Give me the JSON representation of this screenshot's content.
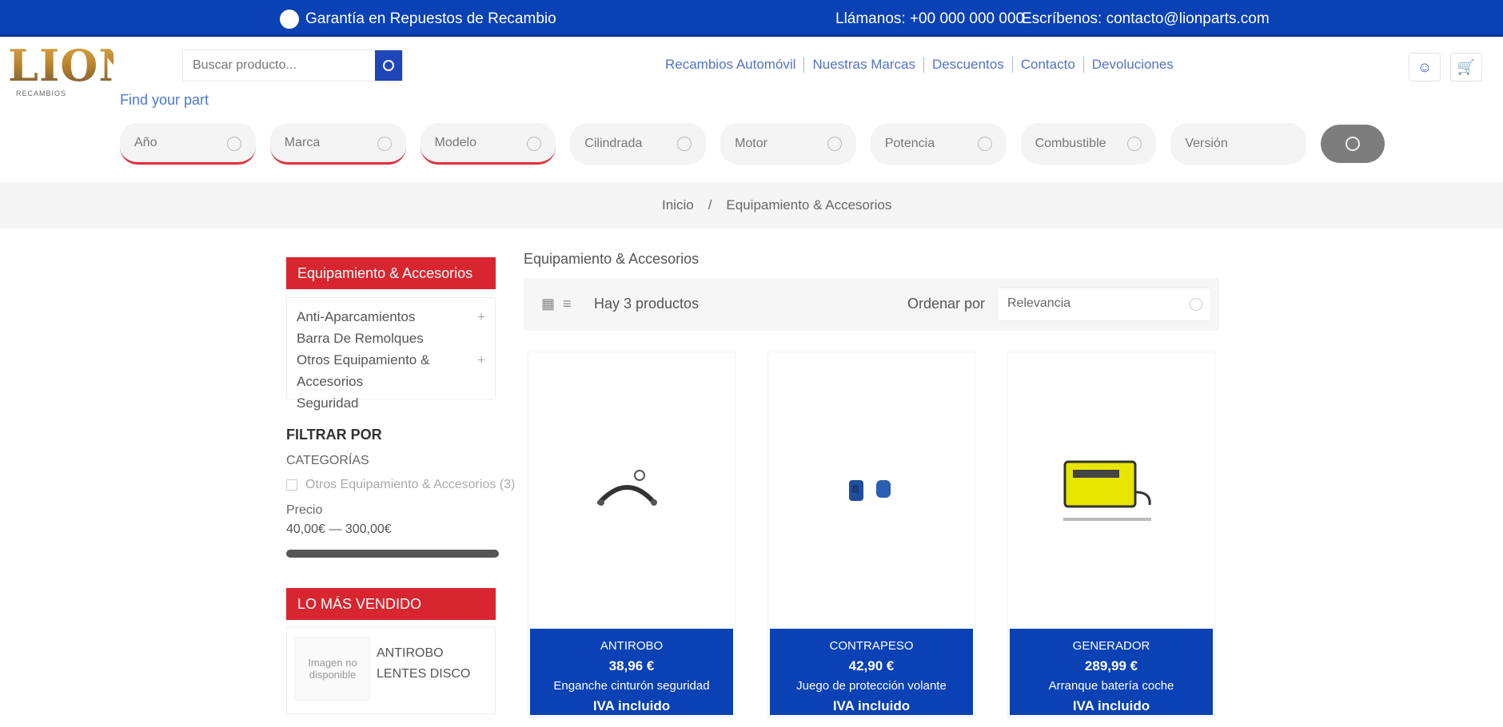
{
  "topbar": {
    "promo": "Garantía en Repuestos de Recambio",
    "phone": "Llámanos: +00 000 000 000",
    "email": "Escríbenos: contacto@lionparts.com"
  },
  "header": {
    "logo_text": "LION",
    "logo_sub": "RECAMBIOS",
    "search_placeholder": "Buscar producto...",
    "find_part": "Find your part",
    "nav": [
      "Recambios Automóvil",
      "Nuestras Marcas",
      "Descuentos",
      "Contacto",
      "Devoluciones"
    ]
  },
  "filters": {
    "items": [
      "Año",
      "Marca",
      "Modelo",
      "Cilindrada",
      "Motor",
      "Potencia",
      "Combustible",
      "Versión"
    ]
  },
  "breadcrumb": [
    "Inicio",
    "/",
    "Equipamiento & Accesorios"
  ],
  "sidebar": {
    "category_title": "Equipamiento & Accesorios",
    "categories": [
      {
        "label": "Anti-Aparcamientos",
        "plus": "+"
      },
      {
        "label": "Barra De Remolques",
        "plus": ""
      },
      {
        "label": "Otros Equipamiento & Accesorios",
        "plus": "+"
      },
      {
        "label": "Seguridad",
        "plus": ""
      }
    ],
    "filter_title": "FILTRAR POR",
    "filter_sub": "CATEGORÍAS",
    "filter_check": "Otros Equipamiento & Accesorios (3)",
    "price_label": "Precio",
    "price_range": "40,00€ — 300,00€",
    "bestsellers_title": "LO MÁS VENDIDO",
    "best_thumb": "Imagen no disponible",
    "best_name": "ANTIROBO LENTES DISCO"
  },
  "content": {
    "title": "Equipamiento & Accesorios",
    "count": "Hay 3 productos",
    "order_label": "Ordenar por",
    "order_value": "Relevancia"
  },
  "products": [
    {
      "l1": "ANTIROBO",
      "l2": "38,96 €",
      "l3": "Enganche cinturón seguridad",
      "l4": "IVA incluido"
    },
    {
      "l1": "CONTRAPESO",
      "l2": "42,90 €",
      "l3": "Juego de protección volante",
      "l4": "IVA incluido"
    },
    {
      "l1": "GENERADOR",
      "l2": "289,99 €",
      "l3": "Arranque batería coche",
      "l4": "IVA incluido"
    }
  ]
}
